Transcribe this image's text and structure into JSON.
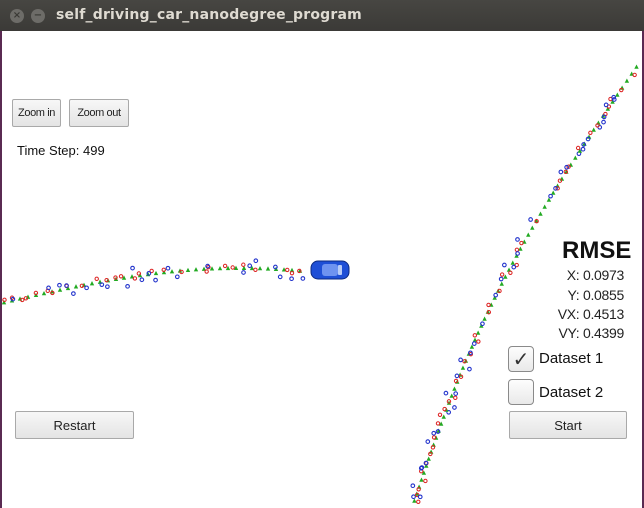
{
  "window": {
    "title": "self_driving_car_nanodegree_program",
    "close_glyph": "×",
    "minimize_glyph": "−"
  },
  "toolbar": {
    "zoom_in": "Zoom in",
    "zoom_out": "Zoom out"
  },
  "sim": {
    "time_step_label": "Time Step: 499"
  },
  "rmse": {
    "title": "RMSE",
    "x": "X: 0.0973",
    "y": "Y: 0.0855",
    "vx": "VX: 0.4513",
    "vy": "VY: 0.4399"
  },
  "datasets": [
    {
      "label": "Dataset 1",
      "checked": true,
      "check_glyph": "✓"
    },
    {
      "label": "Dataset 2",
      "checked": false,
      "check_glyph": ""
    }
  ],
  "controls": {
    "restart": "Restart",
    "start": "Start"
  },
  "colors": {
    "ground_truth": "#22aa22",
    "lidar": "#dd2222",
    "radar": "#2233cc",
    "car": "#1f4fd6"
  },
  "icons": {
    "car": "car-icon",
    "checkmark": "checkmark-icon"
  }
}
